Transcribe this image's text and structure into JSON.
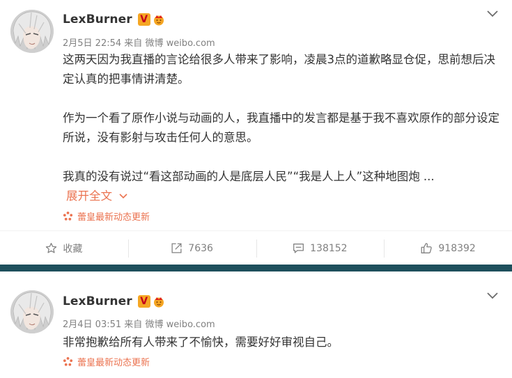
{
  "posts": [
    {
      "username": "LexBurner",
      "verified_badge": "V",
      "date": "2月5日 22:54",
      "via_prefix": "来自",
      "via_source": "微博 weibo.com",
      "paragraphs": [
        "这两天因为我直播的言论给很多人带来了影响，凌晨3点的道歉略显仓促，思前想后决定认真的把事情讲清楚。",
        "作为一个看了原作小说与动画的人，我直播中的发言都是基于我不喜欢原作的部分设定所说，没有影射与攻击任何人的意思。",
        "我真的没有说过“看这部动画的人是底层人民”“我是人上人”这种地图炮 ..."
      ],
      "expand_label": "展开全文",
      "source_tag": "蕾皇最新动态更新",
      "actions": {
        "favorite": "收藏",
        "repost": "7636",
        "comment": "138152",
        "like": "918392"
      }
    },
    {
      "username": "LexBurner",
      "verified_badge": "V",
      "date": "2月4日 03:51",
      "via_prefix": "来自",
      "via_source": "微博 weibo.com",
      "paragraphs": [
        "非常抱歉给所有人带来了不愉快，需要好好审视自己。"
      ],
      "source_tag": "蕾皇最新动态更新"
    }
  ],
  "colors": {
    "accent": "#eb7350",
    "meta_gray": "#808080",
    "divider_band": "#1e4f5c",
    "verified_orange": "#f5a623"
  },
  "icons": [
    "chevron-down-icon",
    "verified-v-icon",
    "crown-badge-icon",
    "sparkle-icon",
    "star-icon",
    "repost-icon",
    "comment-icon",
    "like-icon"
  ]
}
